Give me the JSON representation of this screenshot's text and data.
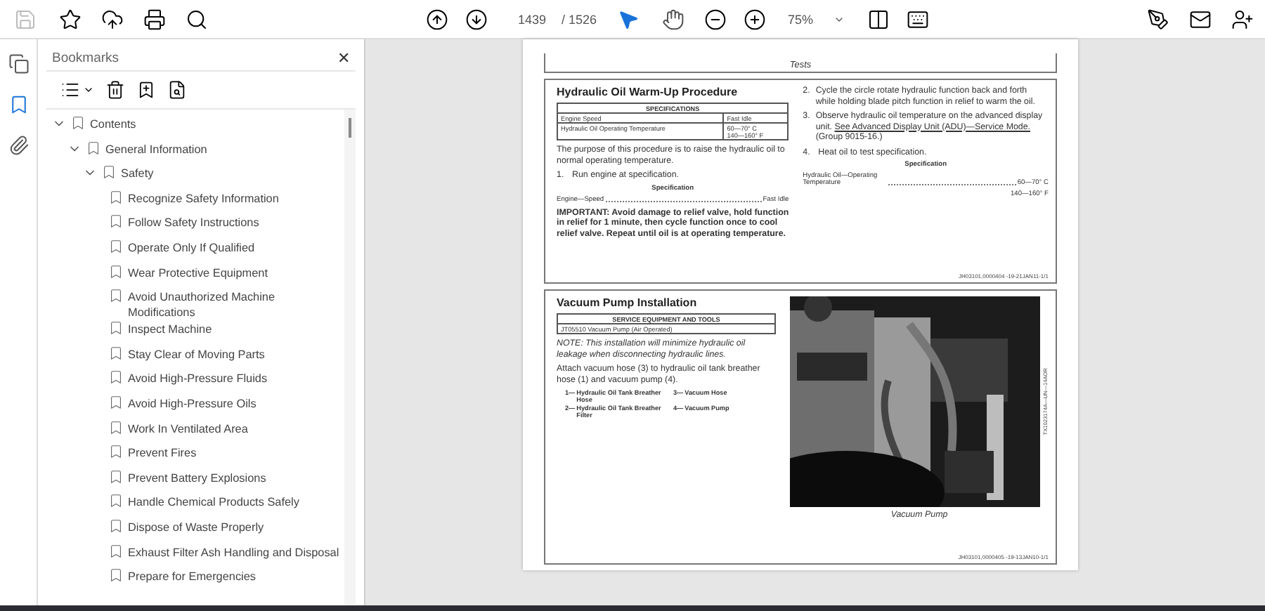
{
  "toolbar": {
    "page_number": "1439",
    "page_count": "/ 1526",
    "zoom": "75%",
    "save_disabled": true,
    "tools": [
      {
        "kind": "select",
        "selected": true
      },
      {
        "kind": "hand",
        "selected": false
      }
    ]
  },
  "rail": [
    {
      "kind": "pages",
      "selected": false
    },
    {
      "kind": "bookmarks",
      "selected": true
    },
    {
      "kind": "attachments",
      "selected": false
    }
  ],
  "bookmarks": {
    "title": "Bookmarks",
    "close": "✕",
    "items": [
      {
        "label": "Contents",
        "expanded": true,
        "children": [
          {
            "label": "General Information",
            "expanded": true,
            "children": [
              {
                "label": "Safety",
                "expanded": true,
                "children": [
                  {
                    "label": "Recognize Safety Information"
                  },
                  {
                    "label": "Follow Safety Instructions"
                  },
                  {
                    "label": "Operate Only If Qualified"
                  },
                  {
                    "label": "Wear Protective Equipment"
                  },
                  {
                    "label": "Avoid Unauthorized Machine Modifications"
                  },
                  {
                    "label": "Inspect Machine"
                  },
                  {
                    "label": "Stay Clear of Moving Parts"
                  },
                  {
                    "label": "Avoid High-Pressure Fluids"
                  },
                  {
                    "label": "Avoid High-Pressure Oils"
                  },
                  {
                    "label": "Work In Ventilated Area"
                  },
                  {
                    "label": "Prevent Fires"
                  },
                  {
                    "label": "Prevent Battery Explosions"
                  },
                  {
                    "label": "Handle Chemical Products Safely"
                  },
                  {
                    "label": "Dispose of Waste Properly"
                  },
                  {
                    "label": "Exhaust Filter Ash Handling and Disposal"
                  },
                  {
                    "label": "Prepare for Emergencies"
                  }
                ]
              }
            ]
          }
        ]
      }
    ]
  },
  "document": {
    "header": "Tests",
    "warmup": {
      "title": "Hydraulic Oil Warm-Up Procedure",
      "spec_table": {
        "heading": "SPECIFICATIONS",
        "rows": [
          [
            "Engine Speed",
            "Fast Idle"
          ],
          [
            "Hydraulic Oil Operating Temperature",
            "60—70° C\n140—160° F"
          ]
        ]
      },
      "intro": "The purpose of this procedure is to raise the hydraulic oil to normal operating temperature.",
      "step1": {
        "number": "1.",
        "text": "Run engine at specification."
      },
      "spec1": {
        "caption": "Specification",
        "name": "Engine—Speed",
        "value": "Fast Idle"
      },
      "important": "IMPORTANT: Avoid damage to relief valve, hold function in relief for 1 minute, then cycle function once to cool relief valve. Repeat until oil is at operating temperature.",
      "step2": {
        "number": "2.",
        "text": "Cycle the circle rotate hydraulic function back and forth while holding blade pitch function in relief to warm the oil."
      },
      "step3": {
        "number": "3.",
        "text": "Observe hydraulic oil temperature on the advanced display unit.",
        "link": "See Advanced Display Unit (ADU)—Service Mode.",
        "after": "(Group 9015-16.)"
      },
      "step4": {
        "number": "4.",
        "text": "Heat oil to test specification."
      },
      "spec2": {
        "caption": "Specification",
        "name": "Hydraulic Oil—Operating Temperature",
        "value": "60—70° C",
        "value2": "140—160° F"
      },
      "code": "JH03101,0000404 -19-21JAN11-1/1"
    },
    "vacuum": {
      "title": "Vacuum Pump Installation",
      "tools_table": {
        "heading": "SERVICE EQUIPMENT AND TOOLS",
        "rows": [
          "JT05510 Vacuum Pump (Air Operated)"
        ]
      },
      "note": "NOTE: This installation will minimize hydraulic oil leakage when disconnecting hydraulic lines.",
      "text": "Attach vacuum hose (3) to hydraulic oil tank breather hose (1) and vacuum pump (4).",
      "legend": [
        {
          "number": "1—",
          "label": "Hydraulic Oil Tank Breather Hose"
        },
        {
          "number": "3—",
          "label": "Vacuum Hose"
        },
        {
          "number": "2—",
          "label": "Hydraulic Oil Tank Breather Filter"
        },
        {
          "number": "4—",
          "label": "Vacuum Pump"
        }
      ],
      "figure_id": "TX1023174A—UN—14AOR",
      "caption": "Vacuum Pump",
      "code": "JH03101,0000405 -19-13JAN10-1/1"
    }
  }
}
